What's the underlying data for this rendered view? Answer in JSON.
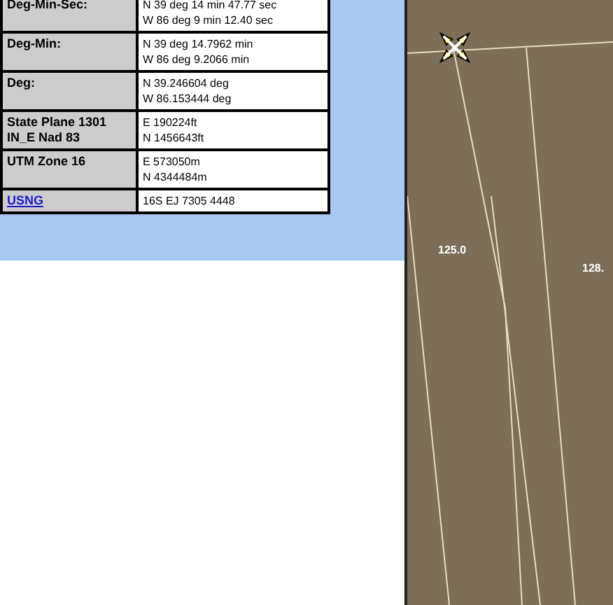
{
  "coordinates": [
    {
      "kind": "text",
      "label": "Deg-Min-Sec:",
      "lines": [
        "N 39 deg 14 min 47.77 sec",
        "W 86 deg 9 min 12.40 sec"
      ]
    },
    {
      "kind": "text",
      "label": "Deg-Min:",
      "lines": [
        "N 39 deg 14.7962 min",
        "W 86 deg 9.2066 min"
      ]
    },
    {
      "kind": "text",
      "label": "Deg:",
      "lines": [
        "N 39.246604 deg",
        "W 86.153444 deg"
      ]
    },
    {
      "kind": "text",
      "label": "State Plane 1301 IN_E Nad 83",
      "lines": [
        "E 190224ft",
        "N 1456643ft"
      ]
    },
    {
      "kind": "text",
      "label": "UTM Zone 16",
      "lines": [
        "E 573050m",
        "N 4344484m"
      ]
    },
    {
      "kind": "link",
      "label": "USNG",
      "lines": [
        "16S EJ 7305 4448"
      ]
    }
  ],
  "map": {
    "labels": [
      "125.0",
      "128."
    ]
  }
}
